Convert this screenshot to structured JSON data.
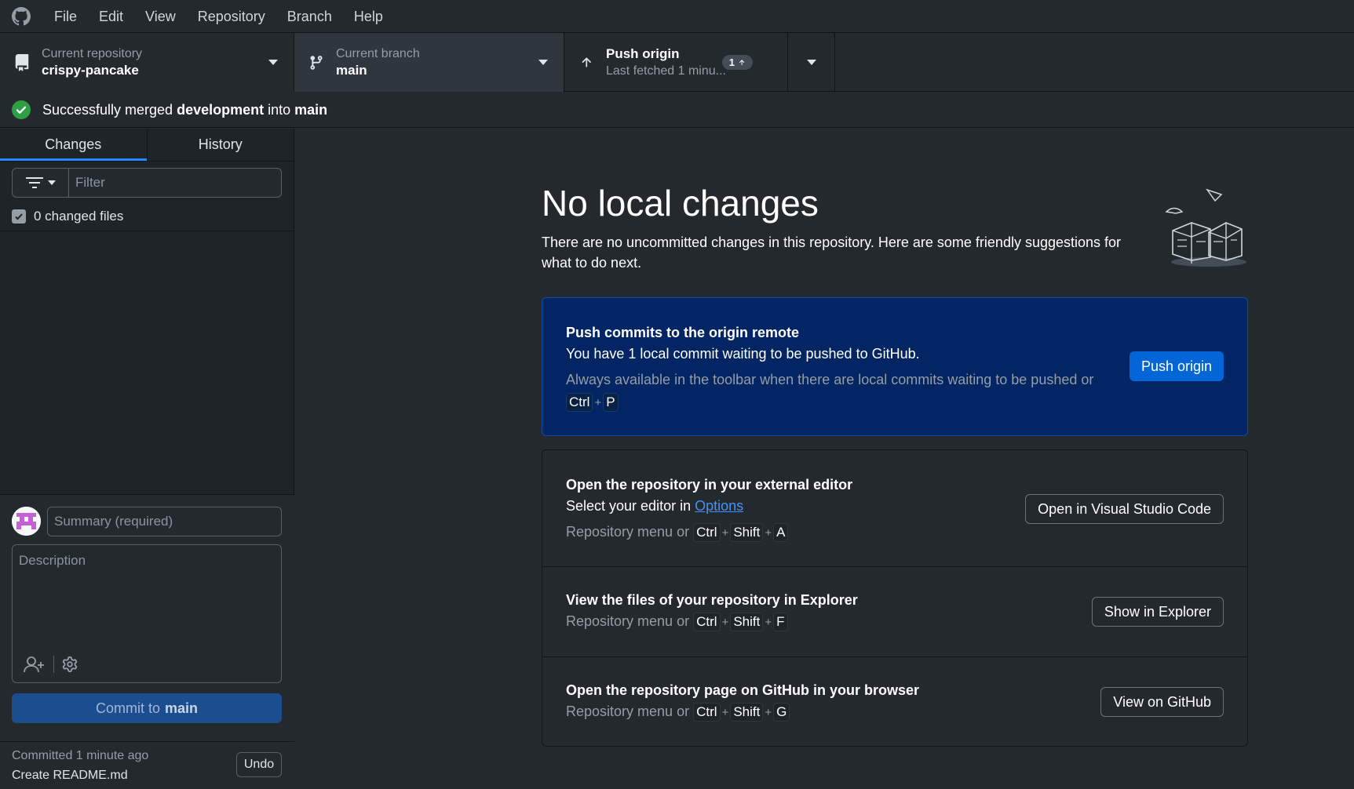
{
  "menubar": {
    "items": [
      "File",
      "Edit",
      "View",
      "Repository",
      "Branch",
      "Help"
    ]
  },
  "toolbar": {
    "repo_label": "Current repository",
    "repo_value": "crispy-pancake",
    "branch_label": "Current branch",
    "branch_value": "main",
    "push_label": "Push origin",
    "push_sub": "Last fetched 1 minu...",
    "push_count": "1"
  },
  "banner": {
    "prefix": "Successfully merged ",
    "source": "development",
    "middle": " into ",
    "target": "main"
  },
  "sidebar": {
    "tab_changes": "Changes",
    "tab_history": "History",
    "filter_placeholder": "Filter",
    "changed_files": "0 changed files",
    "summary_placeholder": "Summary (required)",
    "description_placeholder": "Description",
    "commit_prefix": "Commit to ",
    "commit_branch": "main",
    "last_commit_meta": "Committed 1 minute ago",
    "last_commit_title": "Create README.md",
    "undo_label": "Undo"
  },
  "main": {
    "heading": "No local changes",
    "subtext": "There are no uncommitted changes in this repository. Here are some friendly suggestions for what to do next.",
    "push_card": {
      "title": "Push commits to the origin remote",
      "desc": "You have 1 local commit waiting to be pushed to GitHub.",
      "hint": "Always available in the toolbar when there are local commits waiting to be pushed or",
      "keys": [
        "Ctrl",
        "P"
      ],
      "button": "Push origin"
    },
    "editor_card": {
      "title": "Open the repository in your external editor",
      "desc_prefix": "Select your editor in ",
      "desc_link": "Options",
      "hint": "Repository menu or",
      "keys": [
        "Ctrl",
        "Shift",
        "A"
      ],
      "button": "Open in Visual Studio Code"
    },
    "explorer_card": {
      "title": "View the files of your repository in Explorer",
      "hint": "Repository menu or",
      "keys": [
        "Ctrl",
        "Shift",
        "F"
      ],
      "button": "Show in Explorer"
    },
    "github_card": {
      "title": "Open the repository page on GitHub in your browser",
      "hint": "Repository menu or",
      "keys": [
        "Ctrl",
        "Shift",
        "G"
      ],
      "button": "View on GitHub"
    }
  },
  "colors": {
    "accent": "#0366d6",
    "success": "#2ea043",
    "blue_card": "#032563"
  }
}
